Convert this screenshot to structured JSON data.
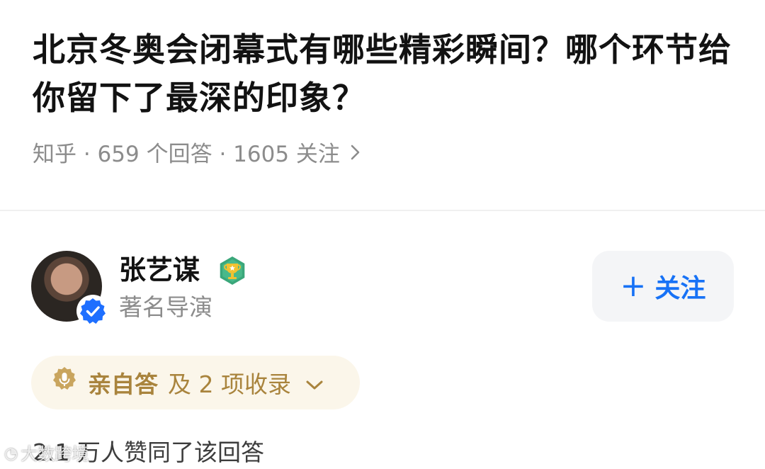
{
  "question": {
    "title": "北京冬奥会闭幕式有哪些精彩瞬间？哪个环节给你留下了最深的印象？",
    "meta": "知乎 · 659 个回答 · 1605 关注"
  },
  "author": {
    "name": "张艺谋",
    "title": "著名导演"
  },
  "follow_button": {
    "plus": "+",
    "label": "关注"
  },
  "collect": {
    "self_label": "亲自答",
    "collect_label": "及 2 项收录"
  },
  "answer": {
    "upvote_text": "2.1 万人赞同了该回答"
  },
  "watermark": {
    "text": "大数跨境"
  },
  "colors": {
    "accent_blue": "#1772f6",
    "verified_blue": "#1e6fff",
    "gold": "#a9843d",
    "gold_bg": "#fbf6ea",
    "medal_green": "#3aa77a",
    "gray_text": "#8c8c8c"
  },
  "icons": {
    "meta_chevron": "chevron-right-icon",
    "verified": "verified-badge-icon",
    "medal": "trophy-medal-icon",
    "collect_badge": "microphone-badge-icon",
    "collect_chevron": "chevron-down-icon"
  }
}
